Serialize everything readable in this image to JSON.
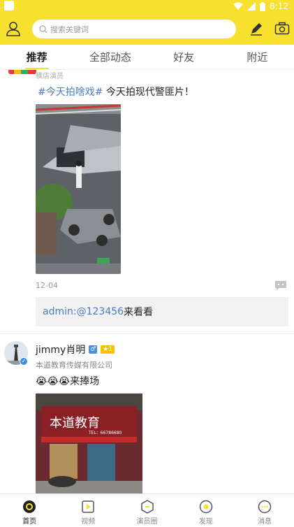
{
  "status_bar": {
    "time": "8:12"
  },
  "search": {
    "placeholder": "搜索关键词"
  },
  "tabs": [
    {
      "label": "推荐",
      "active": true
    },
    {
      "label": "全部动态",
      "active": false
    },
    {
      "label": "好友",
      "active": false
    },
    {
      "label": "附近",
      "active": false
    }
  ],
  "post1": {
    "role": "横店演员",
    "topic": "#今天拍啥戏#",
    "text": " 今天拍现代警匪片！",
    "date": "12-04",
    "comment": {
      "user": "admin:",
      "mention": " @123456",
      "text": " 来看看"
    }
  },
  "post2": {
    "author": "jimmy肖明",
    "gender_badge": "♂",
    "level_badge": "★1",
    "company": "本道教育传媒有限公司",
    "text": "😭😭😭来捧场",
    "photo_sign": "本道教育",
    "photo_sign_tel": "TEL：66786680"
  },
  "bottom_nav": [
    {
      "label": "首页",
      "icon": "home-icon",
      "active": true
    },
    {
      "label": "视频",
      "icon": "video-icon",
      "active": false
    },
    {
      "label": "演员圈",
      "icon": "actor-circle-icon",
      "active": false
    },
    {
      "label": "发现",
      "icon": "discover-icon",
      "active": false
    },
    {
      "label": "消息",
      "icon": "message-icon",
      "active": false
    }
  ],
  "colors": {
    "accent": "#f7e12e",
    "link": "#4a7bc4"
  }
}
